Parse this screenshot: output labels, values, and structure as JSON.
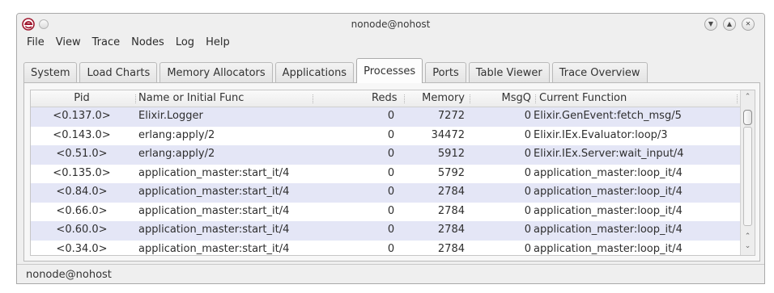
{
  "window": {
    "title": "nonode@nohost",
    "app_icon": "erlang-observer-icon",
    "controls": [
      "minimize-icon",
      "maximize-icon",
      "close-icon"
    ]
  },
  "menu": [
    "File",
    "View",
    "Trace",
    "Nodes",
    "Log",
    "Help"
  ],
  "tabs": [
    {
      "label": "System"
    },
    {
      "label": "Load Charts"
    },
    {
      "label": "Memory Allocators"
    },
    {
      "label": "Applications"
    },
    {
      "label": "Processes",
      "active": true
    },
    {
      "label": "Ports"
    },
    {
      "label": "Table Viewer"
    },
    {
      "label": "Trace Overview"
    }
  ],
  "table": {
    "columns": {
      "pid": "Pid",
      "name": "Name or Initial Func",
      "reds": "Reds",
      "memory": "Memory",
      "msgq": "MsgQ",
      "func": "Current Function"
    },
    "rows": [
      {
        "pid": "<0.137.0>",
        "name": "Elixir.Logger",
        "reds": "0",
        "memory": "7272",
        "msgq": "0",
        "func": "Elixir.GenEvent:fetch_msg/5"
      },
      {
        "pid": "<0.143.0>",
        "name": "erlang:apply/2",
        "reds": "0",
        "memory": "34472",
        "msgq": "0",
        "func": "Elixir.IEx.Evaluator:loop/3"
      },
      {
        "pid": "<0.51.0>",
        "name": "erlang:apply/2",
        "reds": "0",
        "memory": "5912",
        "msgq": "0",
        "func": "Elixir.IEx.Server:wait_input/4"
      },
      {
        "pid": "<0.135.0>",
        "name": "application_master:start_it/4",
        "reds": "0",
        "memory": "5792",
        "msgq": "0",
        "func": "application_master:loop_it/4"
      },
      {
        "pid": "<0.84.0>",
        "name": "application_master:start_it/4",
        "reds": "0",
        "memory": "2784",
        "msgq": "0",
        "func": "application_master:loop_it/4"
      },
      {
        "pid": "<0.66.0>",
        "name": "application_master:start_it/4",
        "reds": "0",
        "memory": "2784",
        "msgq": "0",
        "func": "application_master:loop_it/4"
      },
      {
        "pid": "<0.60.0>",
        "name": "application_master:start_it/4",
        "reds": "0",
        "memory": "2784",
        "msgq": "0",
        "func": "application_master:loop_it/4"
      },
      {
        "pid": "<0.34.0>",
        "name": "application_master:start_it/4",
        "reds": "0",
        "memory": "2784",
        "msgq": "0",
        "func": "application_master:loop_it/4"
      }
    ]
  },
  "status": {
    "text": "nonode@nohost"
  },
  "colors": {
    "row_alt": "#e4e6f6",
    "background": "#efefef"
  }
}
